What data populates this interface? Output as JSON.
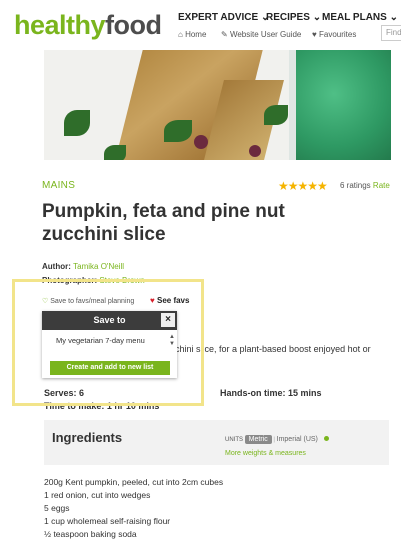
{
  "header": {
    "logo_healthy": "healthy",
    "logo_food": "food",
    "nav": [
      "EXPERT ADVICE",
      "RECIPES",
      "MEAL PLANS"
    ],
    "subnav": [
      "Home",
      "Website User Guide",
      "Favourites"
    ],
    "find_placeholder": "Find"
  },
  "recipe": {
    "category": "MAINS",
    "stars": "★★★★★",
    "ratings_count": "6 ratings",
    "rate_link": "Rate",
    "title": "Pumpkin, feta and pine nut zucchini slice",
    "author_label": "Author:",
    "author_name": "Tamika O'Neill",
    "photographer_label": "Photographer:",
    "photographer_name": "Steve Brown",
    "save_favs": "Save to favs/meal planning",
    "see_favs": "See favs",
    "description_fragment": "chini slice, for a plant-based boost enjoyed hot or",
    "serves": "Serves: 6",
    "hands_on": "Hands-on time: 15 mins",
    "time_to_make": "Time to make: 1 hr 10 mins"
  },
  "popup": {
    "title": "Save to",
    "close": "×",
    "selected_list": "My vegetarian 7-day menu",
    "create_button": "Create and add to new list"
  },
  "ingredients": {
    "title": "Ingredients",
    "units_label": "UNITS",
    "metric": "Metric",
    "imperial": "Imperial (US)",
    "more_link": "More weights & measures",
    "items": [
      "200g Kent pumpkin, peeled, cut into 2cm cubes",
      "1 red onion, cut into wedges",
      "5 eggs",
      "1 cup wholemeal self-raising flour",
      "½ teaspoon baking soda"
    ]
  },
  "colors": {
    "brand_green": "#7ab51d",
    "popup_header": "#3c3c3c",
    "highlight": "#f2e48a",
    "heart": "#d71f2b",
    "star": "#f5b400"
  }
}
